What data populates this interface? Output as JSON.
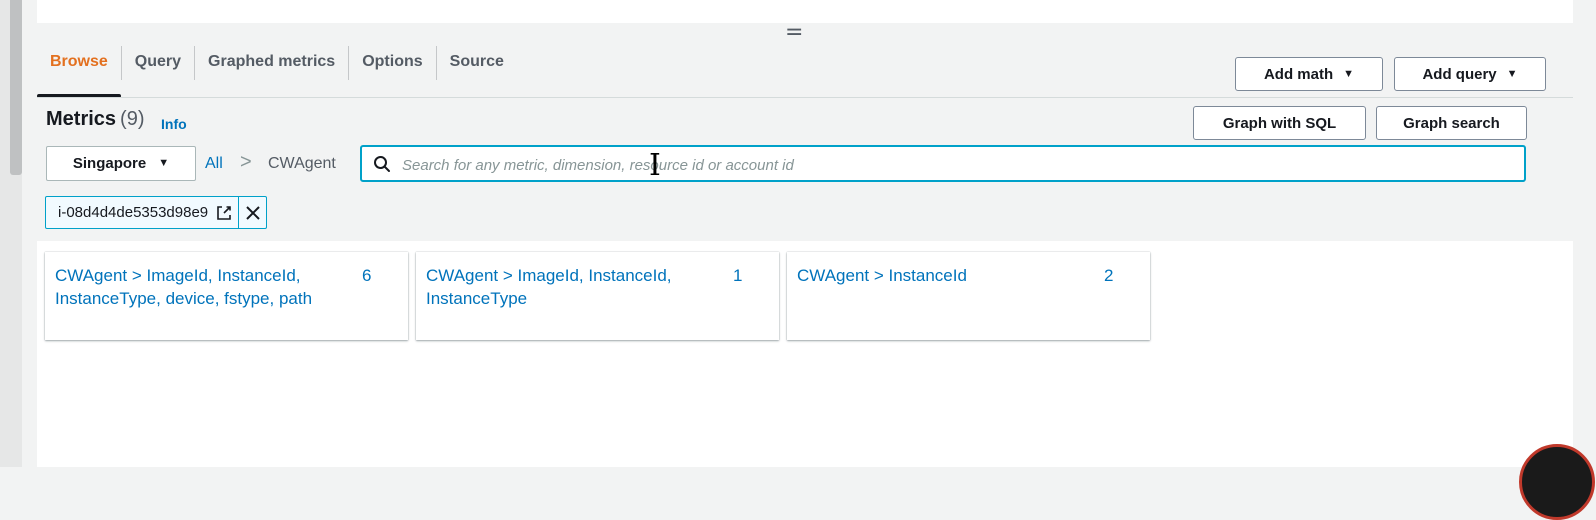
{
  "tabs": [
    "Browse",
    "Query",
    "Graphed metrics",
    "Options",
    "Source"
  ],
  "actions": {
    "add_math": "Add math",
    "add_query": "Add query",
    "graph_sql": "Graph with SQL",
    "graph_search": "Graph search"
  },
  "metrics": {
    "title": "Metrics",
    "count": "(9)",
    "info": "Info"
  },
  "region": "Singapore",
  "breadcrumb": {
    "all": "All",
    "sep": ">",
    "current": "CWAgent"
  },
  "search": {
    "placeholder": "Search for any metric, dimension, resource id or account id",
    "value": ""
  },
  "filter_token": "i-08d4d4de5353d98e9",
  "cards": [
    {
      "title": "CWAgent > ImageId, InstanceId, InstanceType, device, fstype, path",
      "count": "6"
    },
    {
      "title": "CWAgent > ImageId, InstanceId, InstanceType",
      "count": "1"
    },
    {
      "title": "CWAgent > InstanceId",
      "count": "2"
    }
  ],
  "colors": {
    "accent_tab": "#e3701f",
    "link": "#0073bb",
    "focus_border": "#00a1c9"
  },
  "icons": [
    "search-icon",
    "caret-down-icon",
    "edit-icon",
    "close-icon",
    "drag-handle-icon",
    "text-cursor-icon"
  ]
}
